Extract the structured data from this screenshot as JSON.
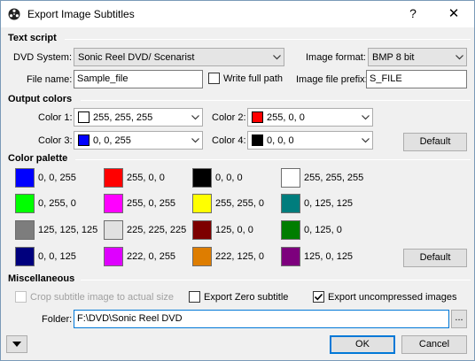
{
  "window": {
    "title": "Export Image Subtitles",
    "help": "?",
    "close": "✕"
  },
  "text_script": {
    "heading": "Text script",
    "dvd_system_label": "DVD System:",
    "dvd_system_value": "Sonic Reel DVD/ Scenarist",
    "image_format_label": "Image format:",
    "image_format_value": "BMP 8 bit",
    "file_name_label": "File name:",
    "file_name_value": "Sample_file",
    "write_full_path_label": "Write full path",
    "write_full_path_checked": false,
    "image_prefix_label": "Image file prefix:",
    "image_prefix_value": "S_FILE"
  },
  "output_colors": {
    "heading": "Output colors",
    "color1": {
      "label": "Color 1:",
      "value": "255, 255, 255",
      "hex": "#ffffff"
    },
    "color2": {
      "label": "Color 2:",
      "value": "255, 0, 0",
      "hex": "#ff0000"
    },
    "color3": {
      "label": "Color 3:",
      "value": "0, 0, 255",
      "hex": "#0000ff"
    },
    "color4": {
      "label": "Color 4:",
      "value": "0, 0, 0",
      "hex": "#000000"
    },
    "default_label": "Default"
  },
  "palette": {
    "heading": "Color palette",
    "items": [
      {
        "label": "0, 0, 255",
        "hex": "#0000ff"
      },
      {
        "label": "255, 0, 0",
        "hex": "#ff0000"
      },
      {
        "label": "0, 0, 0",
        "hex": "#000000"
      },
      {
        "label": "255, 255, 255",
        "hex": "#ffffff"
      },
      {
        "label": "0, 255, 0",
        "hex": "#00ff00"
      },
      {
        "label": "255, 0, 255",
        "hex": "#ff00ff"
      },
      {
        "label": "255, 255, 0",
        "hex": "#ffff00"
      },
      {
        "label": "0, 125, 125",
        "hex": "#007d7d"
      },
      {
        "label": "125, 125, 125",
        "hex": "#7d7d7d"
      },
      {
        "label": "225, 225, 225",
        "hex": "#e1e1e1"
      },
      {
        "label": "125, 0, 0",
        "hex": "#7d0000"
      },
      {
        "label": "0, 125, 0",
        "hex": "#007d00"
      },
      {
        "label": "0, 0, 125",
        "hex": "#00007d"
      },
      {
        "label": "222, 0, 255",
        "hex": "#de00ff"
      },
      {
        "label": "222, 125, 0",
        "hex": "#de7d00"
      },
      {
        "label": "125, 0, 125",
        "hex": "#7d007d"
      }
    ],
    "default_label": "Default"
  },
  "misc": {
    "heading": "Miscellaneous",
    "crop_label": "Crop subtitle image to actual size",
    "crop_checked": false,
    "export_zero_label": "Export Zero subtitle",
    "export_zero_checked": false,
    "export_uncompressed_label": "Export uncompressed images",
    "export_uncompressed_checked": true,
    "folder_label": "Folder:",
    "folder_value": "F:\\DVD\\Sonic Reel DVD",
    "browse_label": "..."
  },
  "footer": {
    "ok_label": "OK",
    "cancel_label": "Cancel"
  }
}
